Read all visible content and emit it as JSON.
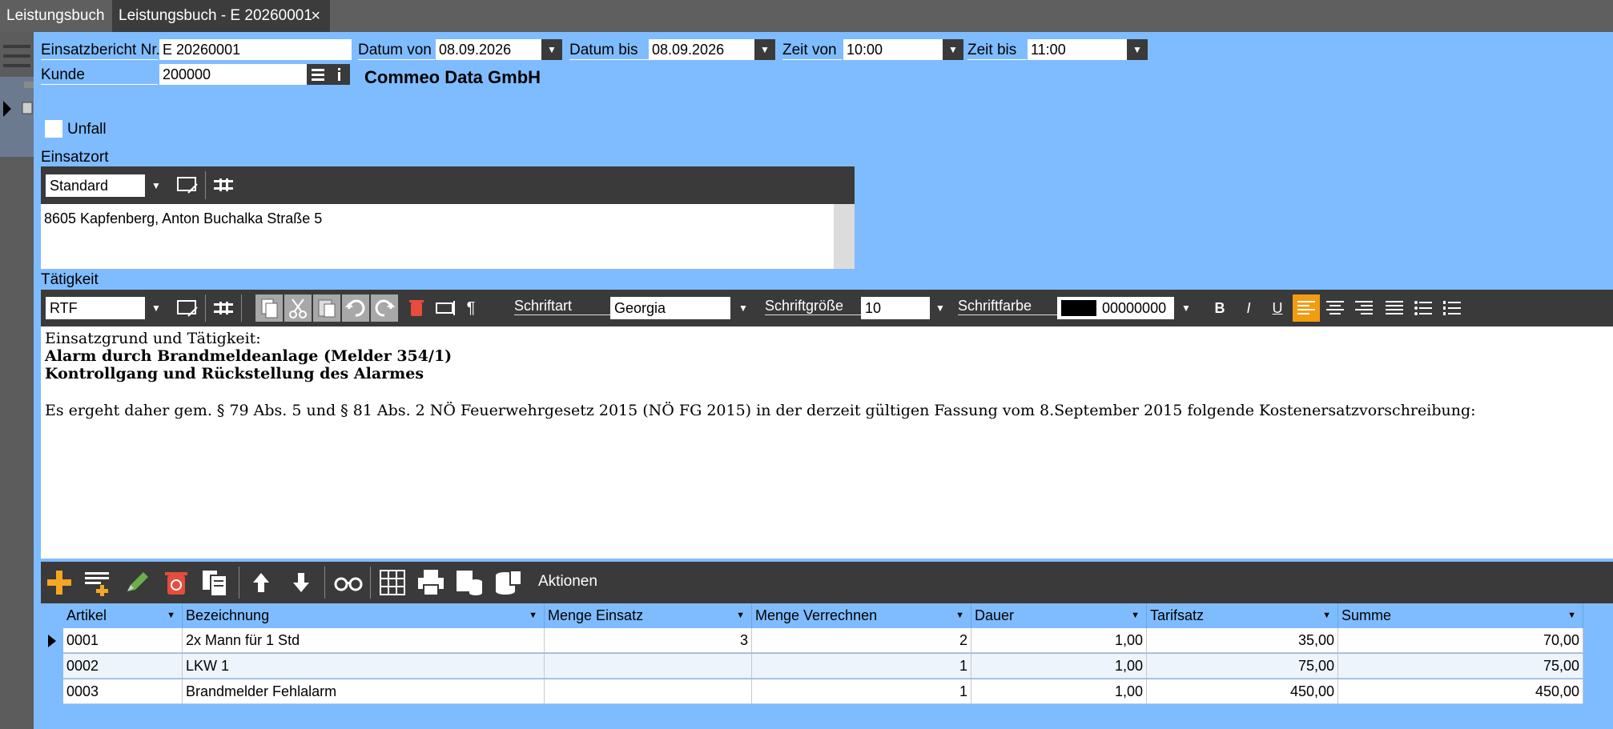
{
  "tabs": [
    {
      "label": "Leistungsbuch"
    },
    {
      "label": "Leistungsbuch - E 20260001",
      "close": "×"
    }
  ],
  "header": {
    "einsatzbericht_label": "Einsatzbericht Nr.",
    "einsatzbericht_value": "E 20260001",
    "datum_von_label": "Datum von",
    "datum_von_value": "08.09.2026",
    "datum_bis_label": "Datum bis",
    "datum_bis_value": "08.09.2026",
    "zeit_von_label": "Zeit von",
    "zeit_von_value": "10:00",
    "zeit_bis_label": "Zeit bis",
    "zeit_bis_value": "11:00",
    "kunde_label": "Kunde",
    "kunde_value": "200000",
    "kunde_name": "Commeo Data GmbH",
    "unfall_label": "Unfall",
    "unfall_checked": false
  },
  "einsatzort": {
    "label": "Einsatzort",
    "selector_value": "Standard",
    "address": "8605 Kapfenberg, Anton Buchalka Straße 5"
  },
  "taetigkeit": {
    "label": "Tätigkeit",
    "format_value": "RTF",
    "schriftart_label": "Schriftart",
    "schriftart_value": "Georgia",
    "schriftgroesse_label": "Schriftgröße",
    "schriftgroesse_value": "10",
    "schriftfarbe_label": "Schriftfarbe",
    "schriftfarbe_value": "00000000",
    "schriftfarbe_color": "#000000",
    "bold_label": "B",
    "italic_label": "I",
    "underline_label": "U",
    "pilcrow": "¶",
    "line1": "Einsatzgrund und Tätigkeit:",
    "line2": "Alarm durch Brandmeldeanlage (Melder 354/1)",
    "line3": "Kontrollgang und Rückstellung des Alarmes",
    "line4": "Es ergeht daher gem. § 79 Abs. 5 und § 81 Abs. 2 NÖ Feuerwehrgesetz 2015 (NÖ FG 2015) in der derzeit gültigen Fassung vom 8.September 2015 folgende Kostenersatzvorschreibung:"
  },
  "grid_toolbar": {
    "aktionen_label": "Aktionen"
  },
  "grid": {
    "columns": [
      "Artikel",
      "Bezeichnung",
      "Menge Einsatz",
      "Menge Verrechnen",
      "Dauer",
      "Tarifsatz",
      "Summe"
    ],
    "rows": [
      {
        "artikel": "0001",
        "bezeichnung": "2x Mann für 1 Std",
        "menge_einsatz": "3",
        "menge_verrechnen": "2",
        "dauer": "1,00",
        "tarifsatz": "35,00",
        "summe": "70,00"
      },
      {
        "artikel": "0002",
        "bezeichnung": "LKW 1",
        "menge_einsatz": "",
        "menge_verrechnen": "1",
        "dauer": "1,00",
        "tarifsatz": "75,00",
        "summe": "75,00"
      },
      {
        "artikel": "0003",
        "bezeichnung": "Brandmelder Fehlalarm",
        "menge_einsatz": "",
        "menge_verrechnen": "1",
        "dauer": "1,00",
        "tarifsatz": "450,00",
        "summe": "450,00"
      }
    ]
  },
  "colors": {
    "panel_bg": "#7fbcff",
    "toolbar_bg": "#3a3a3a",
    "active_align": "#f39c12"
  }
}
